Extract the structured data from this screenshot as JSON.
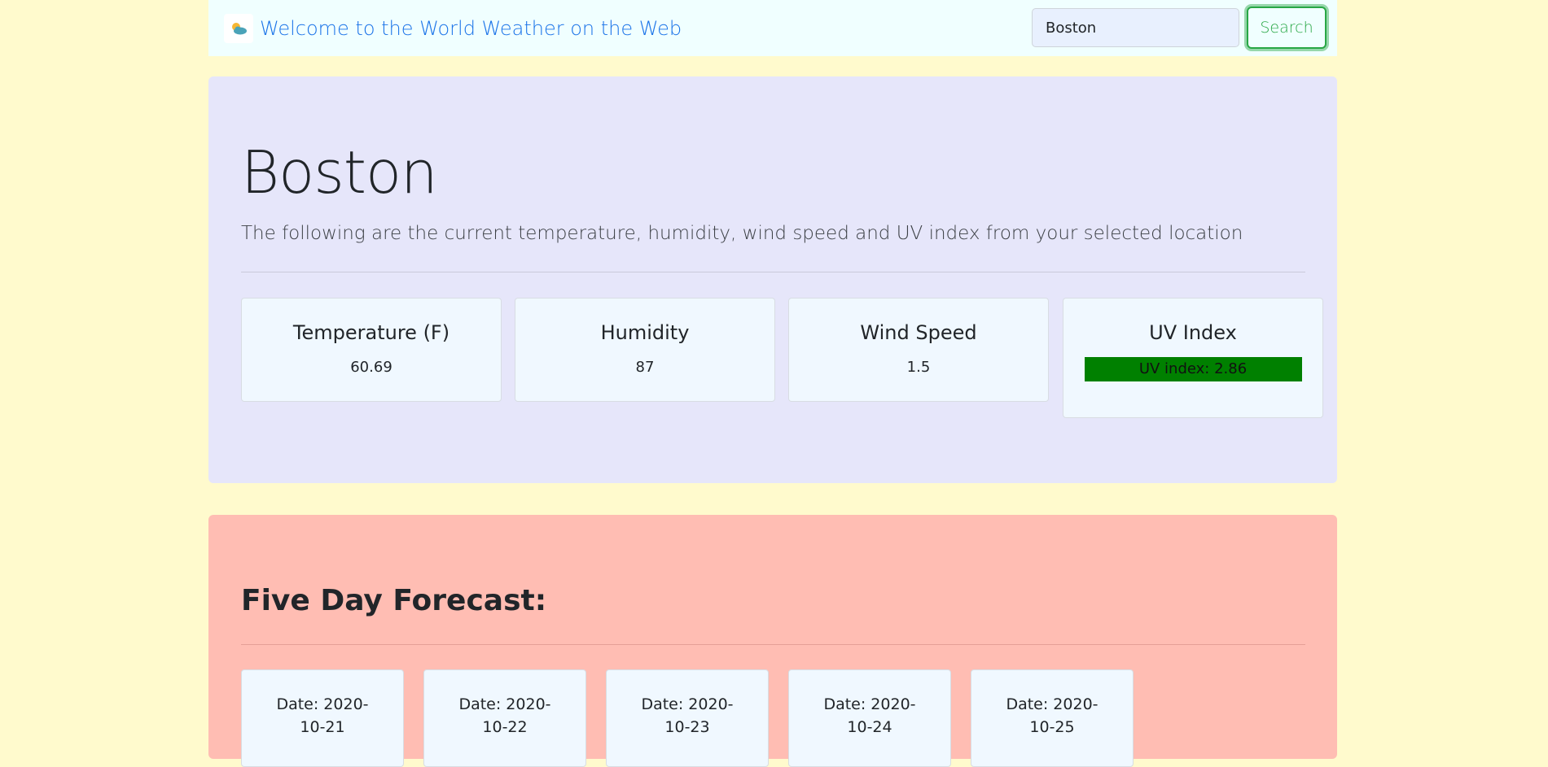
{
  "header": {
    "icon": "sun-behind-cloud-icon",
    "title": "Welcome to the World Weather on the Web",
    "search_value": "Boston",
    "search_label": "Search"
  },
  "current": {
    "city": "Boston",
    "description": "The following are the current temperature, humidity, wind speed and UV index from your selected location",
    "stats": [
      {
        "title": "Temperature (F)",
        "value": "60.69"
      },
      {
        "title": "Humidity",
        "value": "87"
      },
      {
        "title": "Wind Speed",
        "value": "1.5"
      }
    ],
    "uv": {
      "title": "UV Index",
      "label": "UV index: 2.86",
      "value": 2.86,
      "color": "#008000"
    }
  },
  "forecast": {
    "title": "Five Day Forecast:",
    "days": [
      {
        "date": "Date: 2020-10-21"
      },
      {
        "date": "Date: 2020-10-22"
      },
      {
        "date": "Date: 2020-10-23"
      },
      {
        "date": "Date: 2020-10-24"
      },
      {
        "date": "Date: 2020-10-25"
      }
    ]
  },
  "colors": {
    "page_background": "#fffacd",
    "navbar_background": "#f0ffff",
    "current_panel_background": "#e6e6fa",
    "forecast_panel_background": "#ffbdb3",
    "card_background": "#f0f8ff",
    "brand_text": "#1a73e8",
    "search_button": "#28a745"
  }
}
